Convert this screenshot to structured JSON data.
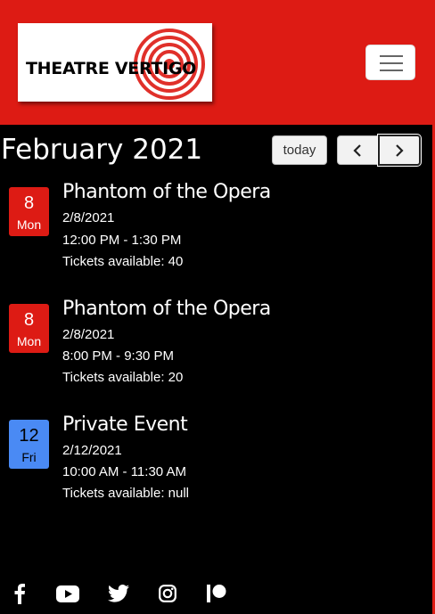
{
  "header": {
    "logo_text": "THEATRE VERTIGO",
    "brand_color": "#dd1b14"
  },
  "calendar": {
    "title": "February 2021",
    "today_label": "today",
    "prev_icon": "chevron-left-icon",
    "next_icon": "chevron-right-icon"
  },
  "events": [
    {
      "day": "8",
      "weekday": "Mon",
      "title": "Phantom of the Opera",
      "date": "2/8/2021",
      "time": "12:00 PM - 1:30 PM",
      "tickets": "Tickets available: 40",
      "color": "#dd1b14"
    },
    {
      "day": "8",
      "weekday": "Mon",
      "title": "Phantom of the Opera",
      "date": "2/8/2021",
      "time": "8:00 PM - 9:30 PM",
      "tickets": "Tickets available: 20",
      "color": "#dd1b14"
    },
    {
      "day": "12",
      "weekday": "Fri",
      "title": "Private Event",
      "date": "2/12/2021",
      "time": "10:00 AM - 11:30 AM",
      "tickets": "Tickets available: null",
      "color": "#4a8af4"
    }
  ],
  "social": [
    "facebook-icon",
    "youtube-icon",
    "twitter-icon",
    "instagram-icon",
    "patreon-icon"
  ]
}
